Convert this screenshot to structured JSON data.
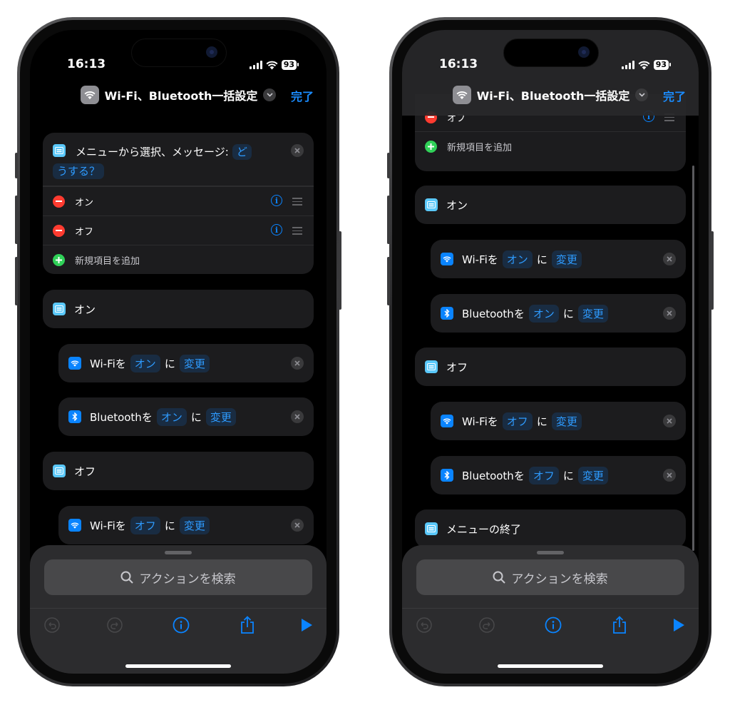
{
  "status": {
    "time": "16:13",
    "battery": "93"
  },
  "nav": {
    "title": "Wi-Fi、Bluetooth一括設定",
    "done": "完了"
  },
  "menu_action": {
    "label": "メニューから選択、メッセージ:",
    "token_part1": "ど",
    "token_part2": "うする？",
    "items": [
      {
        "label": "オン"
      },
      {
        "label": "オフ"
      }
    ],
    "add_item": "新規項目を追加"
  },
  "sections": {
    "on": "オン",
    "off": "オフ",
    "end": "メニューの終了"
  },
  "actions": {
    "wifi_on": {
      "label": "Wi-Fiを",
      "state": "オン",
      "particle": "に",
      "verb": "変更"
    },
    "bt_on": {
      "label": "Bluetoothを",
      "state": "オン",
      "particle": "に",
      "verb": "変更"
    },
    "wifi_off": {
      "label": "Wi-Fiを",
      "state": "オフ",
      "particle": "に",
      "verb": "変更"
    },
    "bt_off": {
      "label": "Bluetoothを",
      "state": "オフ",
      "particle": "に",
      "verb": "変更"
    }
  },
  "search": {
    "placeholder": "アクションを検索"
  },
  "colors": {
    "accent": "#0a84ff",
    "menu_icon": "#5ac8fa",
    "delete": "#ff3b30",
    "add": "#30d158"
  }
}
